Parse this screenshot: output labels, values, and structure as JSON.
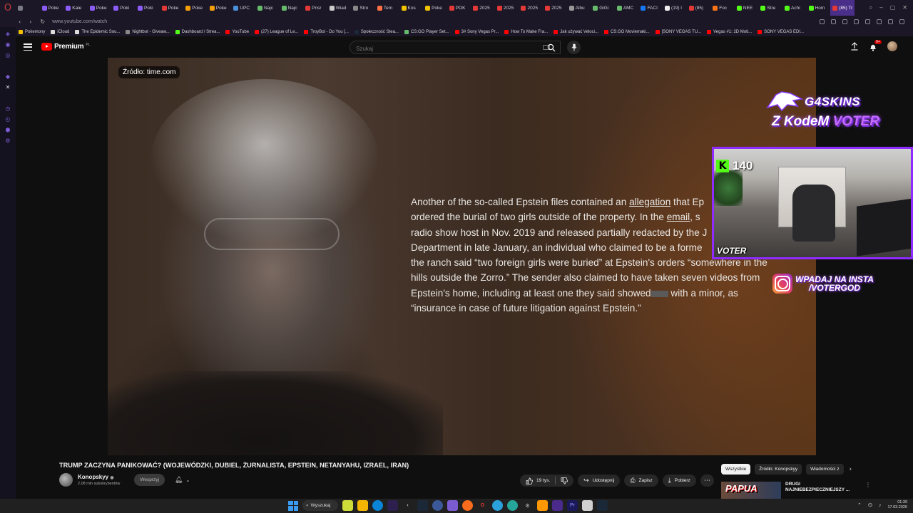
{
  "browser": {
    "tabs": [
      {
        "label": "",
        "color": "#7a7a85"
      },
      {
        "label": "Poke",
        "color": "#8b5cf6"
      },
      {
        "label": "Kale",
        "color": "#8b5cf6"
      },
      {
        "label": "Poke",
        "color": "#8b5cf6"
      },
      {
        "label": "Poki",
        "color": "#8b5cf6"
      },
      {
        "label": "Poki",
        "color": "#8b5cf6"
      },
      {
        "label": "Poke",
        "color": "#e53935"
      },
      {
        "label": "Poke",
        "color": "#f59e0b"
      },
      {
        "label": "Poke",
        "color": "#f59e0b"
      },
      {
        "label": "UPC",
        "color": "#4a90d9"
      },
      {
        "label": "Najc",
        "color": "#66bb6a"
      },
      {
        "label": "Najc",
        "color": "#66bb6a"
      },
      {
        "label": "Prisr",
        "color": "#e53935"
      },
      {
        "label": "Wiad",
        "color": "#cccccc"
      },
      {
        "label": "Stro",
        "color": "#888888"
      },
      {
        "label": "Tem",
        "color": "#ff7043"
      },
      {
        "label": "Kos",
        "color": "#f2c200"
      },
      {
        "label": "Poke",
        "color": "#f2c200"
      },
      {
        "label": "POK",
        "color": "#e53935"
      },
      {
        "label": "2025",
        "color": "#e53935"
      },
      {
        "label": "2025",
        "color": "#e53935"
      },
      {
        "label": "2025",
        "color": "#e53935"
      },
      {
        "label": "2025",
        "color": "#e53935"
      },
      {
        "label": "Albu",
        "color": "#999999"
      },
      {
        "label": "GiGi",
        "color": "#66bb6a"
      },
      {
        "label": "AMC",
        "color": "#66bb6a"
      },
      {
        "label": "FACI",
        "color": "#1877f2"
      },
      {
        "label": "(19) l",
        "color": "#eeeeee"
      },
      {
        "label": "(85)",
        "color": "#e53935"
      },
      {
        "label": "Foc",
        "color": "#f97316"
      },
      {
        "label": "NEE",
        "color": "#53fc18"
      },
      {
        "label": "Stre",
        "color": "#53fc18"
      },
      {
        "label": "Achi",
        "color": "#53fc18"
      },
      {
        "label": "Hom",
        "color": "#53fc18"
      },
      {
        "label": "(85) Tr",
        "color": "#e53935",
        "active": true
      }
    ],
    "address": {
      "url": "www.youtube.com/watch"
    },
    "bookmarks": [
      {
        "label": "Pokemony",
        "color": "#f2c200"
      },
      {
        "label": "iCloud",
        "color": "#dddddd"
      },
      {
        "label": "The Epidemic Sou...",
        "color": "#dddddd"
      },
      {
        "label": "Nightbot - Giveaw...",
        "color": "#888888"
      },
      {
        "label": "Dashboard / Strea...",
        "color": "#53fc18"
      },
      {
        "label": "YouTube",
        "color": "#ff0000"
      },
      {
        "label": "(27) League of Le...",
        "color": "#ff0000"
      },
      {
        "label": "TroyBoi - Do You [...",
        "color": "#ff0000"
      },
      {
        "label": "Społeczność Stea...",
        "color": "#1b2838"
      },
      {
        "label": "CS:GO Player Set...",
        "color": "#66bb6a"
      },
      {
        "label": "3# Sony Vegas Pr...",
        "color": "#ff0000"
      },
      {
        "label": "How To Make Fra...",
        "color": "#ff0000"
      },
      {
        "label": "Jak używać Veloci...",
        "color": "#ff0000"
      },
      {
        "label": "CS:GO Moviemaki...",
        "color": "#ff0000"
      },
      {
        "label": "[SONY VEGAS TU...",
        "color": "#ff0000"
      },
      {
        "label": "Vegas #1: 2D Moti...",
        "color": "#ff0000"
      },
      {
        "label": "SONY VEGAS EDI...",
        "color": "#ff0000"
      }
    ]
  },
  "youtube": {
    "logo_text": "Premium",
    "logo_country": "PL",
    "search": {
      "placeholder": "Szukaj"
    },
    "notifications_badge": "9+",
    "video": {
      "source_chip": "Źródło: time.com",
      "article": {
        "p1": "Another of the so-called Epstein files  contained an ",
        "link1": "allegation",
        "p2": " that Ep",
        "p3": "ordered the burial of two girls outside of the property. In the ",
        "link2": "email",
        "p4": ", s",
        "p5": "radio show host in Nov. 2019 and released partially redacted by the J",
        "p6": "Department in late January, an individual who claimed to be a forme",
        "p7": "the ranch said “two foreign girls were buried” at Epstein's orders “somewhere in the",
        "p8": "hills outside the Zorro.” The sender also claimed to have taken seven videos from",
        "p9": "Epstein's home, including at least one they said showed",
        "p10": " with a minor, as",
        "p11": "“insurance in case of future litigation against Epstein.”"
      }
    },
    "overlay": {
      "brand": "G4SKINS",
      "code_prefix": "Z KodeM ",
      "code": "VOTER",
      "viewer_count": "140",
      "cam_name": "VOTER",
      "insta_line1": "WPADAJ NA INSTA",
      "insta_line2": "/VOTERGOD"
    },
    "title": "TRUMP ZACZYNA PANIKOWAĆ? (WOJEWÓDZKI, DUBIEL, ŻURNALISTA, EPSTEIN, NETANYAHU, IZRAEL, IRAN)",
    "channel": {
      "name": "Konopskyy",
      "verified": "◉",
      "subs": "2,08 mln subskrybentów",
      "support_label": "Wesprzyj"
    },
    "actions": {
      "likes": "19 tys.",
      "share": "Udostępnij",
      "save": "Zapisz",
      "download": "Pobierz"
    },
    "chips": [
      "Wszystkie",
      "Źródło: Konopskyy",
      "Wiadomości z"
    ],
    "recommendation": {
      "thumb_text": "PAPUA",
      "title": "DRUGI NAJNIEBEZPIECZNIEJSZY ..."
    }
  },
  "taskbar": {
    "search_label": "Wyszukaj",
    "time": "01:39",
    "date": "17.03.2026"
  }
}
